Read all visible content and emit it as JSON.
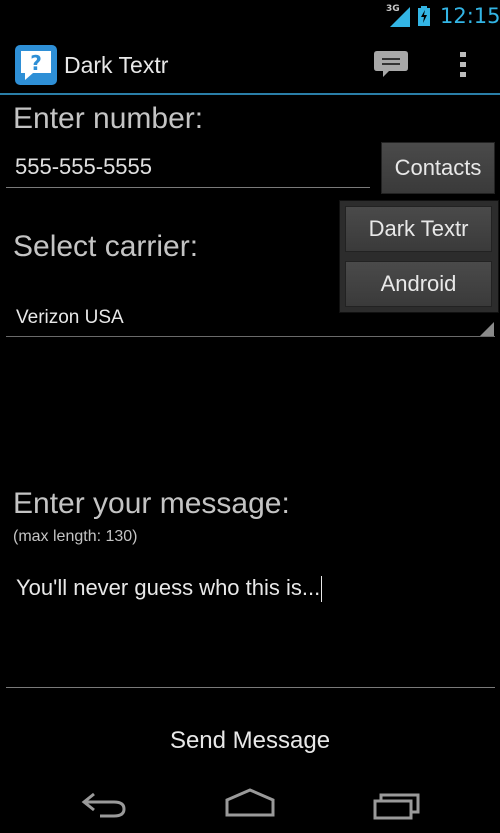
{
  "status_bar": {
    "network_type": "3G",
    "time": "12:15",
    "icons": [
      "signal-icon",
      "battery-charging-icon"
    ]
  },
  "action_bar": {
    "title": "Dark Textr",
    "icons": [
      "app-icon",
      "compose-icon",
      "overflow-menu-icon"
    ]
  },
  "form": {
    "number_label": "Enter number:",
    "number_value": "555-555-5555",
    "contacts_button": "Contacts",
    "carrier_label": "Select carrier:",
    "carrier_value": "Verizon USA",
    "message_label": "Enter your message:",
    "max_length_note": "(max length: 130)",
    "message_value": "You'll never guess who this is...",
    "send_button": "Send Message"
  },
  "popup_menu": {
    "items": [
      "Dark Textr",
      "Android"
    ]
  },
  "nav_bar": {
    "icons": [
      "back-icon",
      "home-icon",
      "recents-icon"
    ]
  },
  "colors": {
    "accent": "#33b5e5",
    "background": "#000000",
    "button": "#444444"
  }
}
